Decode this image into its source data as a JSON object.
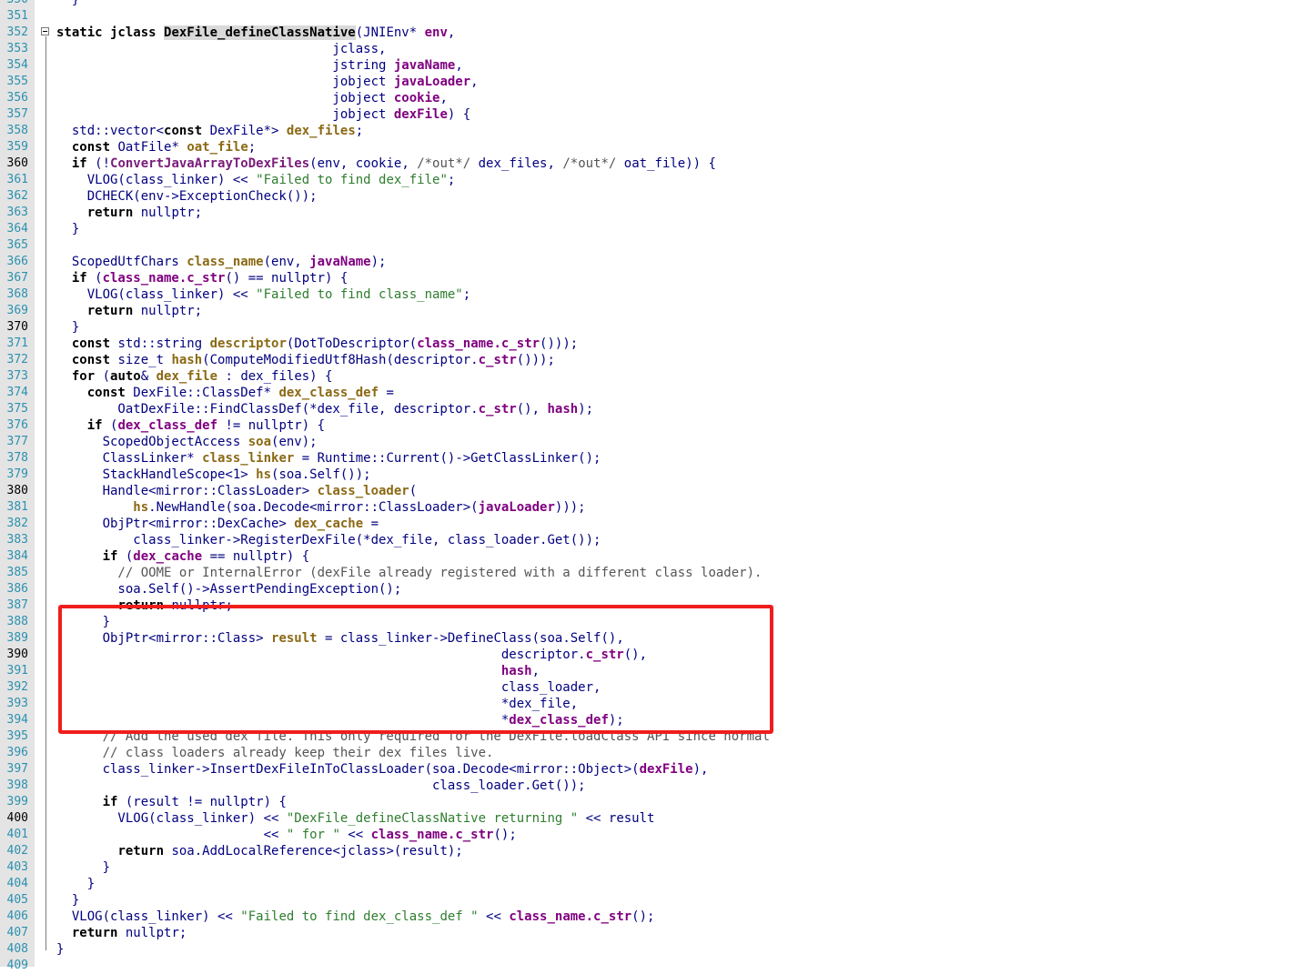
{
  "editor": {
    "colors": {
      "identifier": "#000080",
      "keyword": "#000000",
      "variable": "#8b6914",
      "param": "#800080",
      "function": "#7a1c7a",
      "string": "#2e7d2e",
      "comment": "#555555",
      "line_number": "#2b91af",
      "annotation_box": "#f01d1d"
    },
    "lines": [
      {
        "n": "350",
        "tokens": [
          {
            "t": "  }",
            "c": "p"
          }
        ]
      },
      {
        "n": "351",
        "tokens": []
      },
      {
        "n": "352",
        "fold": true,
        "tokens": [
          {
            "t": "static jclass ",
            "c": "kw"
          },
          {
            "t": "DexFile_defineClassNative",
            "c": "kw",
            "hl": true
          },
          {
            "t": "(JNIEnv* ",
            "c": "p"
          },
          {
            "t": "env",
            "c": "par"
          },
          {
            "t": ",",
            "c": "p"
          }
        ]
      },
      {
        "n": "353",
        "tokens": [
          {
            "t": "                                    jclass,",
            "c": "p"
          }
        ]
      },
      {
        "n": "354",
        "tokens": [
          {
            "t": "                                    jstring ",
            "c": "p"
          },
          {
            "t": "javaName",
            "c": "par"
          },
          {
            "t": ",",
            "c": "p"
          }
        ]
      },
      {
        "n": "355",
        "tokens": [
          {
            "t": "                                    jobject ",
            "c": "p"
          },
          {
            "t": "javaLoader",
            "c": "par"
          },
          {
            "t": ",",
            "c": "p"
          }
        ]
      },
      {
        "n": "356",
        "tokens": [
          {
            "t": "                                    jobject ",
            "c": "p"
          },
          {
            "t": "cookie",
            "c": "par"
          },
          {
            "t": ",",
            "c": "p"
          }
        ]
      },
      {
        "n": "357",
        "tokens": [
          {
            "t": "                                    jobject ",
            "c": "p"
          },
          {
            "t": "dexFile",
            "c": "par"
          },
          {
            "t": ") {",
            "c": "p"
          }
        ]
      },
      {
        "n": "358",
        "tokens": [
          {
            "t": "  std::vector<",
            "c": "p"
          },
          {
            "t": "const",
            "c": "kw"
          },
          {
            "t": " DexFile*> ",
            "c": "p"
          },
          {
            "t": "dex_files",
            "c": "var"
          },
          {
            "t": ";",
            "c": "p"
          }
        ]
      },
      {
        "n": "359",
        "tokens": [
          {
            "t": "  ",
            "c": "p"
          },
          {
            "t": "const",
            "c": "kw"
          },
          {
            "t": " OatFile* ",
            "c": "p"
          },
          {
            "t": "oat_file",
            "c": "var"
          },
          {
            "t": ";",
            "c": "p"
          }
        ]
      },
      {
        "n": "360",
        "cur": true,
        "tokens": [
          {
            "t": "  ",
            "c": "p"
          },
          {
            "t": "if",
            "c": "kw"
          },
          {
            "t": " (!",
            "c": "p"
          },
          {
            "t": "ConvertJavaArrayToDexFiles",
            "c": "fn"
          },
          {
            "t": "(env, cookie, ",
            "c": "p"
          },
          {
            "t": "/*out*/",
            "c": "cm"
          },
          {
            "t": " dex_files, ",
            "c": "p"
          },
          {
            "t": "/*out*/",
            "c": "cm"
          },
          {
            "t": " oat_file)) {",
            "c": "p"
          }
        ]
      },
      {
        "n": "361",
        "tokens": [
          {
            "t": "    VLOG(class_linker) << ",
            "c": "p"
          },
          {
            "t": "\"Failed to find dex_file\"",
            "c": "str"
          },
          {
            "t": ";",
            "c": "p"
          }
        ]
      },
      {
        "n": "362",
        "tokens": [
          {
            "t": "    DCHECK(env->ExceptionCheck());",
            "c": "p"
          }
        ]
      },
      {
        "n": "363",
        "tokens": [
          {
            "t": "    ",
            "c": "p"
          },
          {
            "t": "return",
            "c": "kw"
          },
          {
            "t": " nullptr;",
            "c": "p"
          }
        ]
      },
      {
        "n": "364",
        "tokens": [
          {
            "t": "  }",
            "c": "p"
          }
        ]
      },
      {
        "n": "365",
        "tokens": []
      },
      {
        "n": "366",
        "tokens": [
          {
            "t": "  ScopedUtfChars ",
            "c": "p"
          },
          {
            "t": "class_name",
            "c": "var"
          },
          {
            "t": "(env, ",
            "c": "p"
          },
          {
            "t": "javaName",
            "c": "par"
          },
          {
            "t": ");",
            "c": "p"
          }
        ]
      },
      {
        "n": "367",
        "tokens": [
          {
            "t": "  ",
            "c": "p"
          },
          {
            "t": "if",
            "c": "kw"
          },
          {
            "t": " (",
            "c": "p"
          },
          {
            "t": "class_name.c_str",
            "c": "par"
          },
          {
            "t": "() == nullptr) {",
            "c": "p"
          }
        ]
      },
      {
        "n": "368",
        "tokens": [
          {
            "t": "    VLOG(class_linker) << ",
            "c": "p"
          },
          {
            "t": "\"Failed to find class_name\"",
            "c": "str"
          },
          {
            "t": ";",
            "c": "p"
          }
        ]
      },
      {
        "n": "369",
        "tokens": [
          {
            "t": "    ",
            "c": "p"
          },
          {
            "t": "return",
            "c": "kw"
          },
          {
            "t": " nullptr;",
            "c": "p"
          }
        ]
      },
      {
        "n": "370",
        "cur": true,
        "tokens": [
          {
            "t": "  }",
            "c": "p"
          }
        ]
      },
      {
        "n": "371",
        "tokens": [
          {
            "t": "  ",
            "c": "p"
          },
          {
            "t": "const",
            "c": "kw"
          },
          {
            "t": " std::string ",
            "c": "p"
          },
          {
            "t": "descriptor",
            "c": "var"
          },
          {
            "t": "(DotToDescriptor(",
            "c": "p"
          },
          {
            "t": "class_name.c_str",
            "c": "par"
          },
          {
            "t": "()));",
            "c": "p"
          }
        ]
      },
      {
        "n": "372",
        "tokens": [
          {
            "t": "  ",
            "c": "p"
          },
          {
            "t": "const",
            "c": "kw"
          },
          {
            "t": " size_t ",
            "c": "p"
          },
          {
            "t": "hash",
            "c": "var"
          },
          {
            "t": "(ComputeModifiedUtf8Hash(descriptor.",
            "c": "p"
          },
          {
            "t": "c_str",
            "c": "par"
          },
          {
            "t": "()));",
            "c": "p"
          }
        ]
      },
      {
        "n": "373",
        "tokens": [
          {
            "t": "  ",
            "c": "p"
          },
          {
            "t": "for",
            "c": "kw"
          },
          {
            "t": " (",
            "c": "p"
          },
          {
            "t": "auto",
            "c": "kw"
          },
          {
            "t": "& ",
            "c": "p"
          },
          {
            "t": "dex_file",
            "c": "var"
          },
          {
            "t": " : dex_files) {",
            "c": "p"
          }
        ]
      },
      {
        "n": "374",
        "tokens": [
          {
            "t": "    ",
            "c": "p"
          },
          {
            "t": "const",
            "c": "kw"
          },
          {
            "t": " DexFile::ClassDef* ",
            "c": "p"
          },
          {
            "t": "dex_class_def",
            "c": "var"
          },
          {
            "t": " =",
            "c": "p"
          }
        ]
      },
      {
        "n": "375",
        "tokens": [
          {
            "t": "        OatDexFile::FindClassDef(*dex_file, descriptor.",
            "c": "p"
          },
          {
            "t": "c_str",
            "c": "par"
          },
          {
            "t": "(), ",
            "c": "p"
          },
          {
            "t": "hash",
            "c": "par"
          },
          {
            "t": ");",
            "c": "p"
          }
        ]
      },
      {
        "n": "376",
        "tokens": [
          {
            "t": "    ",
            "c": "p"
          },
          {
            "t": "if",
            "c": "kw"
          },
          {
            "t": " (",
            "c": "p"
          },
          {
            "t": "dex_class_def",
            "c": "par"
          },
          {
            "t": " != nullptr) {",
            "c": "p"
          }
        ]
      },
      {
        "n": "377",
        "tokens": [
          {
            "t": "      ScopedObjectAccess ",
            "c": "p"
          },
          {
            "t": "soa",
            "c": "var"
          },
          {
            "t": "(env);",
            "c": "p"
          }
        ]
      },
      {
        "n": "378",
        "tokens": [
          {
            "t": "      ClassLinker* ",
            "c": "p"
          },
          {
            "t": "class_linker",
            "c": "var"
          },
          {
            "t": " = Runtime::Current()->GetClassLinker();",
            "c": "p"
          }
        ]
      },
      {
        "n": "379",
        "tokens": [
          {
            "t": "      StackHandleScope<1> ",
            "c": "p"
          },
          {
            "t": "hs",
            "c": "var"
          },
          {
            "t": "(soa.Self());",
            "c": "p"
          }
        ]
      },
      {
        "n": "380",
        "cur": true,
        "tokens": [
          {
            "t": "      Handle<mirror::ClassLoader> ",
            "c": "p"
          },
          {
            "t": "class_loader",
            "c": "var"
          },
          {
            "t": "(",
            "c": "p"
          }
        ]
      },
      {
        "n": "381",
        "tokens": [
          {
            "t": "          ",
            "c": "p"
          },
          {
            "t": "hs",
            "c": "var"
          },
          {
            "t": ".NewHandle(soa.Decode<mirror::ClassLoader>(",
            "c": "p"
          },
          {
            "t": "javaLoader",
            "c": "par"
          },
          {
            "t": ")));",
            "c": "p"
          }
        ]
      },
      {
        "n": "382",
        "tokens": [
          {
            "t": "      ObjPtr<mirror::DexCache> ",
            "c": "p"
          },
          {
            "t": "dex_cache",
            "c": "var"
          },
          {
            "t": " =",
            "c": "p"
          }
        ]
      },
      {
        "n": "383",
        "tokens": [
          {
            "t": "          class_linker->RegisterDexFile(*dex_file, class_loader.Get());",
            "c": "p"
          }
        ]
      },
      {
        "n": "384",
        "tokens": [
          {
            "t": "      ",
            "c": "p"
          },
          {
            "t": "if",
            "c": "kw"
          },
          {
            "t": " (",
            "c": "p"
          },
          {
            "t": "dex_cache",
            "c": "par"
          },
          {
            "t": " == nullptr) {",
            "c": "p"
          }
        ]
      },
      {
        "n": "385",
        "tokens": [
          {
            "t": "        // OOME or InternalError (dexFile already registered with a different class loader).",
            "c": "cm"
          }
        ]
      },
      {
        "n": "386",
        "tokens": [
          {
            "t": "        soa.Self()->AssertPendingException();",
            "c": "p"
          }
        ]
      },
      {
        "n": "387",
        "tokens": [
          {
            "t": "        ",
            "c": "p"
          },
          {
            "t": "return",
            "c": "kw"
          },
          {
            "t": " nullptr;",
            "c": "p"
          }
        ]
      },
      {
        "n": "388",
        "tokens": [
          {
            "t": "      }",
            "c": "p"
          }
        ]
      },
      {
        "n": "389",
        "tokens": [
          {
            "t": "      ObjPtr<mirror::Class> ",
            "c": "p"
          },
          {
            "t": "result",
            "c": "var"
          },
          {
            "t": " = class_linker->DefineClass(soa.Self(),",
            "c": "p"
          }
        ]
      },
      {
        "n": "390",
        "cur": true,
        "tokens": [
          {
            "t": "                                                          descriptor.",
            "c": "p"
          },
          {
            "t": "c_str",
            "c": "par"
          },
          {
            "t": "(),",
            "c": "p"
          }
        ]
      },
      {
        "n": "391",
        "tokens": [
          {
            "t": "                                                          ",
            "c": "p"
          },
          {
            "t": "hash",
            "c": "par"
          },
          {
            "t": ",",
            "c": "p"
          }
        ]
      },
      {
        "n": "392",
        "tokens": [
          {
            "t": "                                                          class_loader,",
            "c": "p"
          }
        ]
      },
      {
        "n": "393",
        "tokens": [
          {
            "t": "                                                          *dex_file,",
            "c": "p"
          }
        ]
      },
      {
        "n": "394",
        "tokens": [
          {
            "t": "                                                          *",
            "c": "p"
          },
          {
            "t": "dex_class_def",
            "c": "par"
          },
          {
            "t": ");",
            "c": "p"
          }
        ]
      },
      {
        "n": "395",
        "tokens": [
          {
            "t": "      // Add the used dex file. This only required for the DexFile.loadClass API since normal",
            "c": "cm"
          }
        ]
      },
      {
        "n": "396",
        "tokens": [
          {
            "t": "      // class loaders already keep their dex files live.",
            "c": "cm"
          }
        ]
      },
      {
        "n": "397",
        "tokens": [
          {
            "t": "      class_linker->InsertDexFileInToClassLoader(soa.Decode<mirror::Object>(",
            "c": "p"
          },
          {
            "t": "dexFile",
            "c": "par"
          },
          {
            "t": "),",
            "c": "p"
          }
        ]
      },
      {
        "n": "398",
        "tokens": [
          {
            "t": "                                                 class_loader.Get());",
            "c": "p"
          }
        ]
      },
      {
        "n": "399",
        "tokens": [
          {
            "t": "      ",
            "c": "p"
          },
          {
            "t": "if",
            "c": "kw"
          },
          {
            "t": " (result != nullptr) {",
            "c": "p"
          }
        ]
      },
      {
        "n": "400",
        "cur": true,
        "tokens": [
          {
            "t": "        VLOG(class_linker) << ",
            "c": "p"
          },
          {
            "t": "\"DexFile_defineClassNative returning \"",
            "c": "str"
          },
          {
            "t": " << result",
            "c": "p"
          }
        ]
      },
      {
        "n": "401",
        "tokens": [
          {
            "t": "                           << ",
            "c": "p"
          },
          {
            "t": "\" for \"",
            "c": "str"
          },
          {
            "t": " << ",
            "c": "p"
          },
          {
            "t": "class_name.c_str",
            "c": "par"
          },
          {
            "t": "();",
            "c": "p"
          }
        ]
      },
      {
        "n": "402",
        "tokens": [
          {
            "t": "        ",
            "c": "p"
          },
          {
            "t": "return",
            "c": "kw"
          },
          {
            "t": " soa.AddLocalReference<jclass>(result);",
            "c": "p"
          }
        ]
      },
      {
        "n": "403",
        "tokens": [
          {
            "t": "      }",
            "c": "p"
          }
        ]
      },
      {
        "n": "404",
        "tokens": [
          {
            "t": "    }",
            "c": "p"
          }
        ]
      },
      {
        "n": "405",
        "tokens": [
          {
            "t": "  }",
            "c": "p"
          }
        ]
      },
      {
        "n": "406",
        "tokens": [
          {
            "t": "  VLOG(class_linker) << ",
            "c": "p"
          },
          {
            "t": "\"Failed to find dex_class_def \"",
            "c": "str"
          },
          {
            "t": " << ",
            "c": "p"
          },
          {
            "t": "class_name.c_str",
            "c": "par"
          },
          {
            "t": "();",
            "c": "p"
          }
        ]
      },
      {
        "n": "407",
        "tokens": [
          {
            "t": "  ",
            "c": "p"
          },
          {
            "t": "return",
            "c": "kw"
          },
          {
            "t": " nullptr;",
            "c": "p"
          }
        ]
      },
      {
        "n": "408",
        "tokens": [
          {
            "t": "}",
            "c": "p"
          }
        ]
      },
      {
        "n": "409",
        "tokens": []
      }
    ]
  }
}
